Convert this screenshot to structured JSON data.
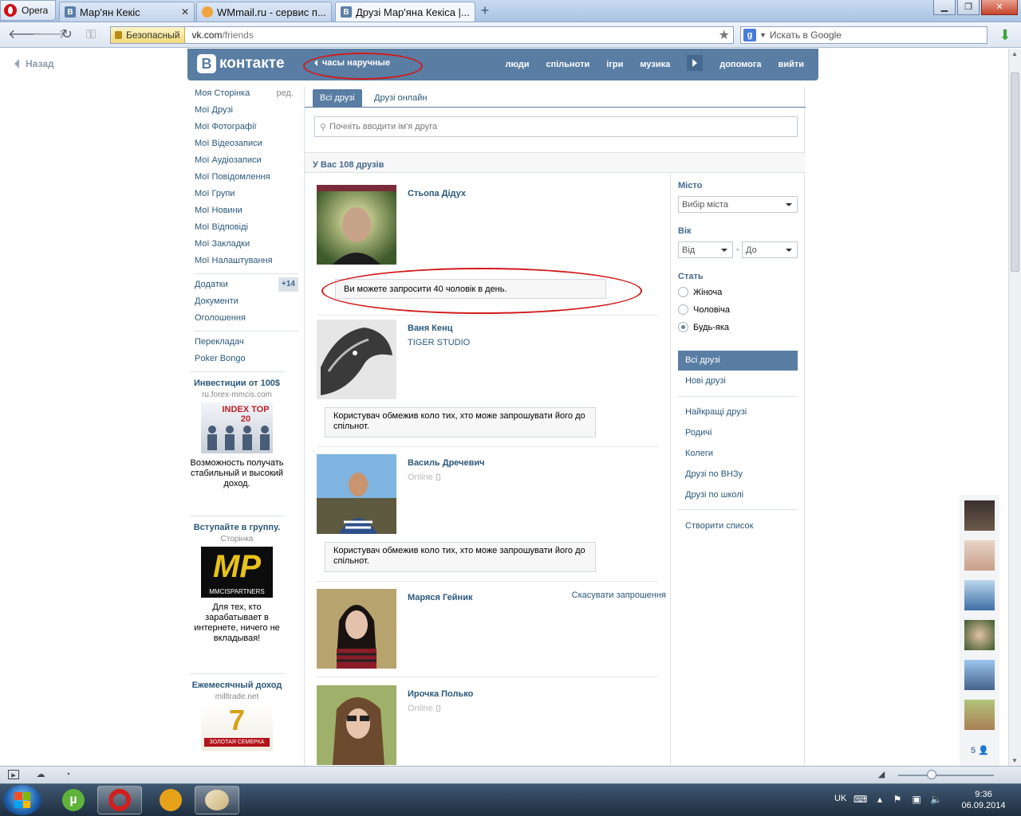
{
  "browser": {
    "opera_label": "Opera",
    "tabs": [
      {
        "title": "Мар'ян Кекіс",
        "favicon": "vk-icon"
      },
      {
        "title": "WMmail.ru - сервис п...",
        "favicon": "wmmail-icon"
      },
      {
        "title": "Друзі Мар'яна Кекіса |...",
        "favicon": "vk-icon"
      }
    ],
    "secure_label": "Безопасный",
    "url_host": "vk.com",
    "url_path": "/friends",
    "search_placeholder": "Искать в Google"
  },
  "page": {
    "back_label": "Назад",
    "logo_text": "контакте",
    "logo_letter": "B",
    "status_text": "часы наручные",
    "topnav": [
      "люди",
      "спільноти",
      "ігри",
      "музика",
      "допомога",
      "вийти"
    ],
    "left_menu": {
      "my_page": "Моя Сторінка",
      "edit": "ред.",
      "items": [
        "Мої Друзі",
        "Мої Фотографії",
        "Мої Відеозаписи",
        "Мої Аудіозаписи",
        "Мої Повідомлення",
        "Мої Групи",
        "Мої Новини",
        "Мої Відповіді",
        "Мої Закладки",
        "Мої Налаштування"
      ],
      "apps": "Додатки",
      "apps_badge": "+14",
      "items2": [
        "Документи",
        "Оголошення"
      ],
      "items3": [
        "Перекладач",
        "Poker Bongo"
      ]
    },
    "ads": [
      {
        "title": "Инвестиции от 100$",
        "sub": "ru.forex-mmcis.com",
        "text": "Возможность получать стабильный и высокий доход.",
        "img_label": "INDEX TOP 20"
      },
      {
        "title": "Вступайте в группу.",
        "sub": "Сторінка",
        "text": "Для тех, кто зарабатывает в интернете, ничего не вкладывая!",
        "img_label": "MP",
        "img_sub": "MMCISPARTNERS"
      },
      {
        "title": "Ежемесячный доход",
        "sub": "milltrade.net",
        "img_label": "7",
        "img_sub": "ЗОЛОТАЯ СЕМЕРКА"
      }
    ],
    "tabs": [
      "Всі друзі",
      "Друзі онлайн"
    ],
    "filter_placeholder": "Почніть вводити ім'я друга",
    "summary": "У Вас 108 друзів",
    "friends": [
      {
        "name": "Стьопа Дідух",
        "notice": "Ви можете запросити 40 чоловік в день."
      },
      {
        "name": "Ваня Кенц",
        "sub": "TIGER STUDIO",
        "notice": "Користувач обмежив коло тих, хто може запрошувати його до спільнот."
      },
      {
        "name": "Василь Дречевич",
        "online": "Online",
        "notice": "Користувач обмежив коло тих, хто може запрошувати його до спільнот."
      },
      {
        "name": "Маряся Гейник",
        "action": "Скасувати запрошення"
      },
      {
        "name": "Ирочка Полько",
        "online": "Online"
      }
    ],
    "filter": {
      "city_label": "Місто",
      "city_select": "Вибір міста",
      "age_label": "Вік",
      "age_from": "Від",
      "age_dash": "-",
      "age_to": "До",
      "sex_label": "Стать",
      "sex_options": [
        "Жіноча",
        "Чоловіча",
        "Будь-яка"
      ],
      "sex_selected": 2,
      "lists1": [
        "Всі друзі",
        "Нові друзі"
      ],
      "lists2": [
        "Найкращі друзі",
        "Родичі",
        "Колеги",
        "Друзі по ВНЗу",
        "Друзі по школі"
      ],
      "create_list": "Створити список"
    },
    "chat_count": "5"
  },
  "taskbar": {
    "lang": "UK",
    "time": "9:36",
    "date": "06.09.2014"
  },
  "colors": {
    "vk_blue": "#597da3",
    "link": "#2b587a",
    "annotation_red": "#d11a1a"
  }
}
